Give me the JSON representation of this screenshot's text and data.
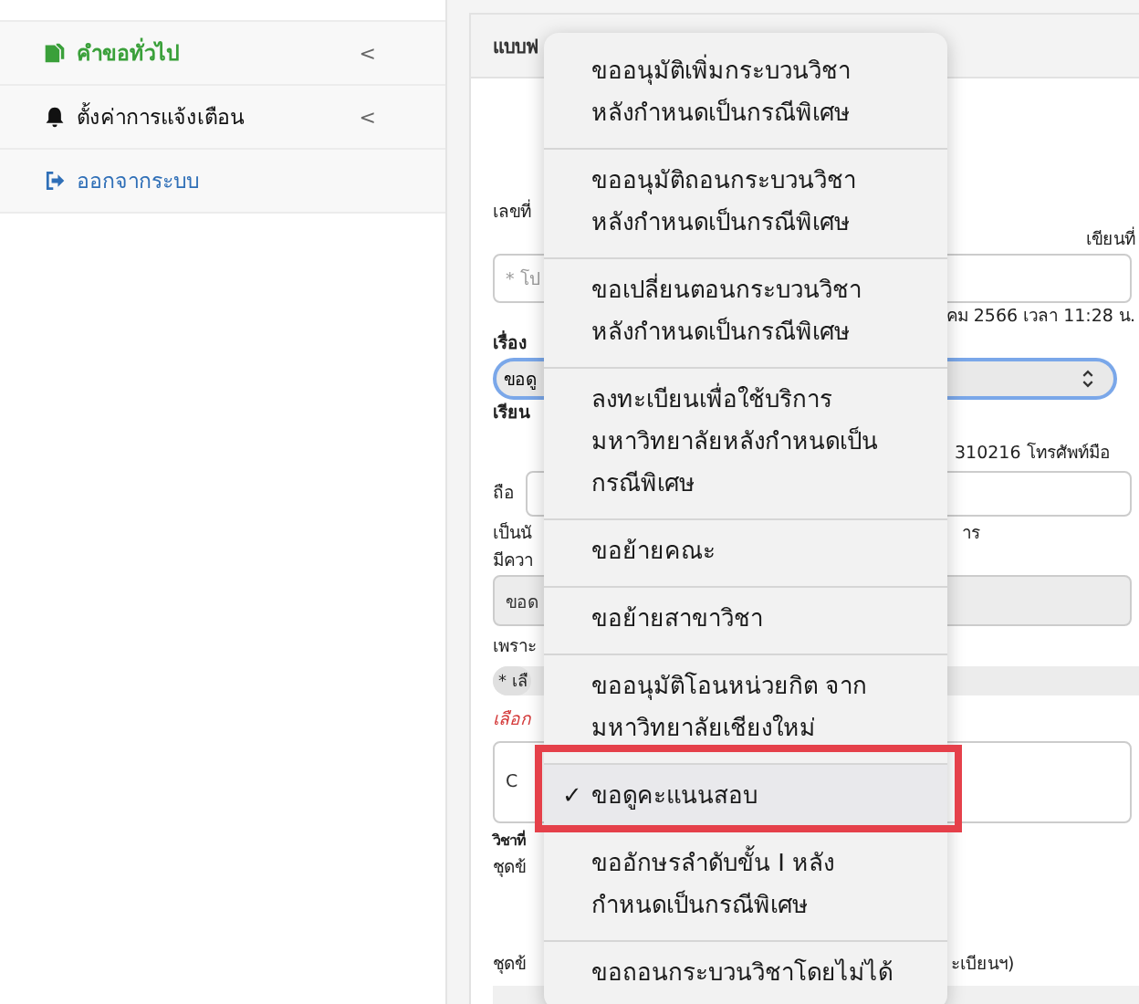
{
  "sidebar": {
    "items": [
      {
        "label": "คำขอทั่วไป",
        "chevron": "<",
        "selected": true
      },
      {
        "label": "ตั้งค่าการแจ้งเตือน",
        "chevron": "<",
        "selected": false
      },
      {
        "label": "ออกจากระบบ",
        "selected": false
      }
    ]
  },
  "form": {
    "title": "แบบฟ",
    "number_label": "เลขที่",
    "written_at_label": "เขียนที่",
    "number_placeholder": "* โป",
    "date_text": "คม 2566 เวลา 11:28 น.",
    "subject_label": "เรื่อง",
    "subject_value": "ขอดู",
    "to_label": "เรียน",
    "phone_text": "310216  โทรศัพท์มือ",
    "mobile_label": "ถือ",
    "student_text_left": "เป็นนั",
    "student_text_right": "าร",
    "wish_label": "มีควา",
    "wish_value": "ขอด",
    "because_label": "เพราะ",
    "reason_chip": "* เลื",
    "choose_hint": "เลือก",
    "details_value": "C",
    "course_label": "วิชาที่",
    "dataset_label_1": "ชุดข้",
    "dataset_label_2": "ชุดข้",
    "dataset_note": "ะเบียนฯ)"
  },
  "dropdown": {
    "check_mark": "✓",
    "options": [
      {
        "label": "ขออนุมัติเพิ่มกระบวนวิชา\nหลังกำหนดเป็นกรณีพิเศษ",
        "selected": false
      },
      {
        "label": "ขออนุมัติถอนกระบวนวิชา\nหลังกำหนดเป็นกรณีพิเศษ",
        "selected": false
      },
      {
        "label": "ขอเปลี่ยนตอนกระบวนวิชา\nหลังกำหนดเป็นกรณีพิเศษ",
        "selected": false
      },
      {
        "label": "ลงทะเบียนเพื่อใช้บริการ\nมหาวิทยาลัยหลังกำหนดเป็น\nกรณีพิเศษ",
        "selected": false
      },
      {
        "label": "ขอย้ายคณะ",
        "selected": false
      },
      {
        "label": "ขอย้ายสาขาวิชา",
        "selected": false
      },
      {
        "label": "ขออนุมัติโอนหน่วยกิต จาก\nมหาวิทยาลัยเชียงใหม่",
        "selected": false
      },
      {
        "label": "ขอดูคะแนนสอบ",
        "selected": true
      },
      {
        "label": "ขออักษรลำดับขั้น I หลัง\nกำหนดเป็นกรณีพิเศษ",
        "selected": false
      },
      {
        "label": "ขอถอนกระบวนวิชาโดยไม่ได้",
        "selected": false
      }
    ]
  }
}
